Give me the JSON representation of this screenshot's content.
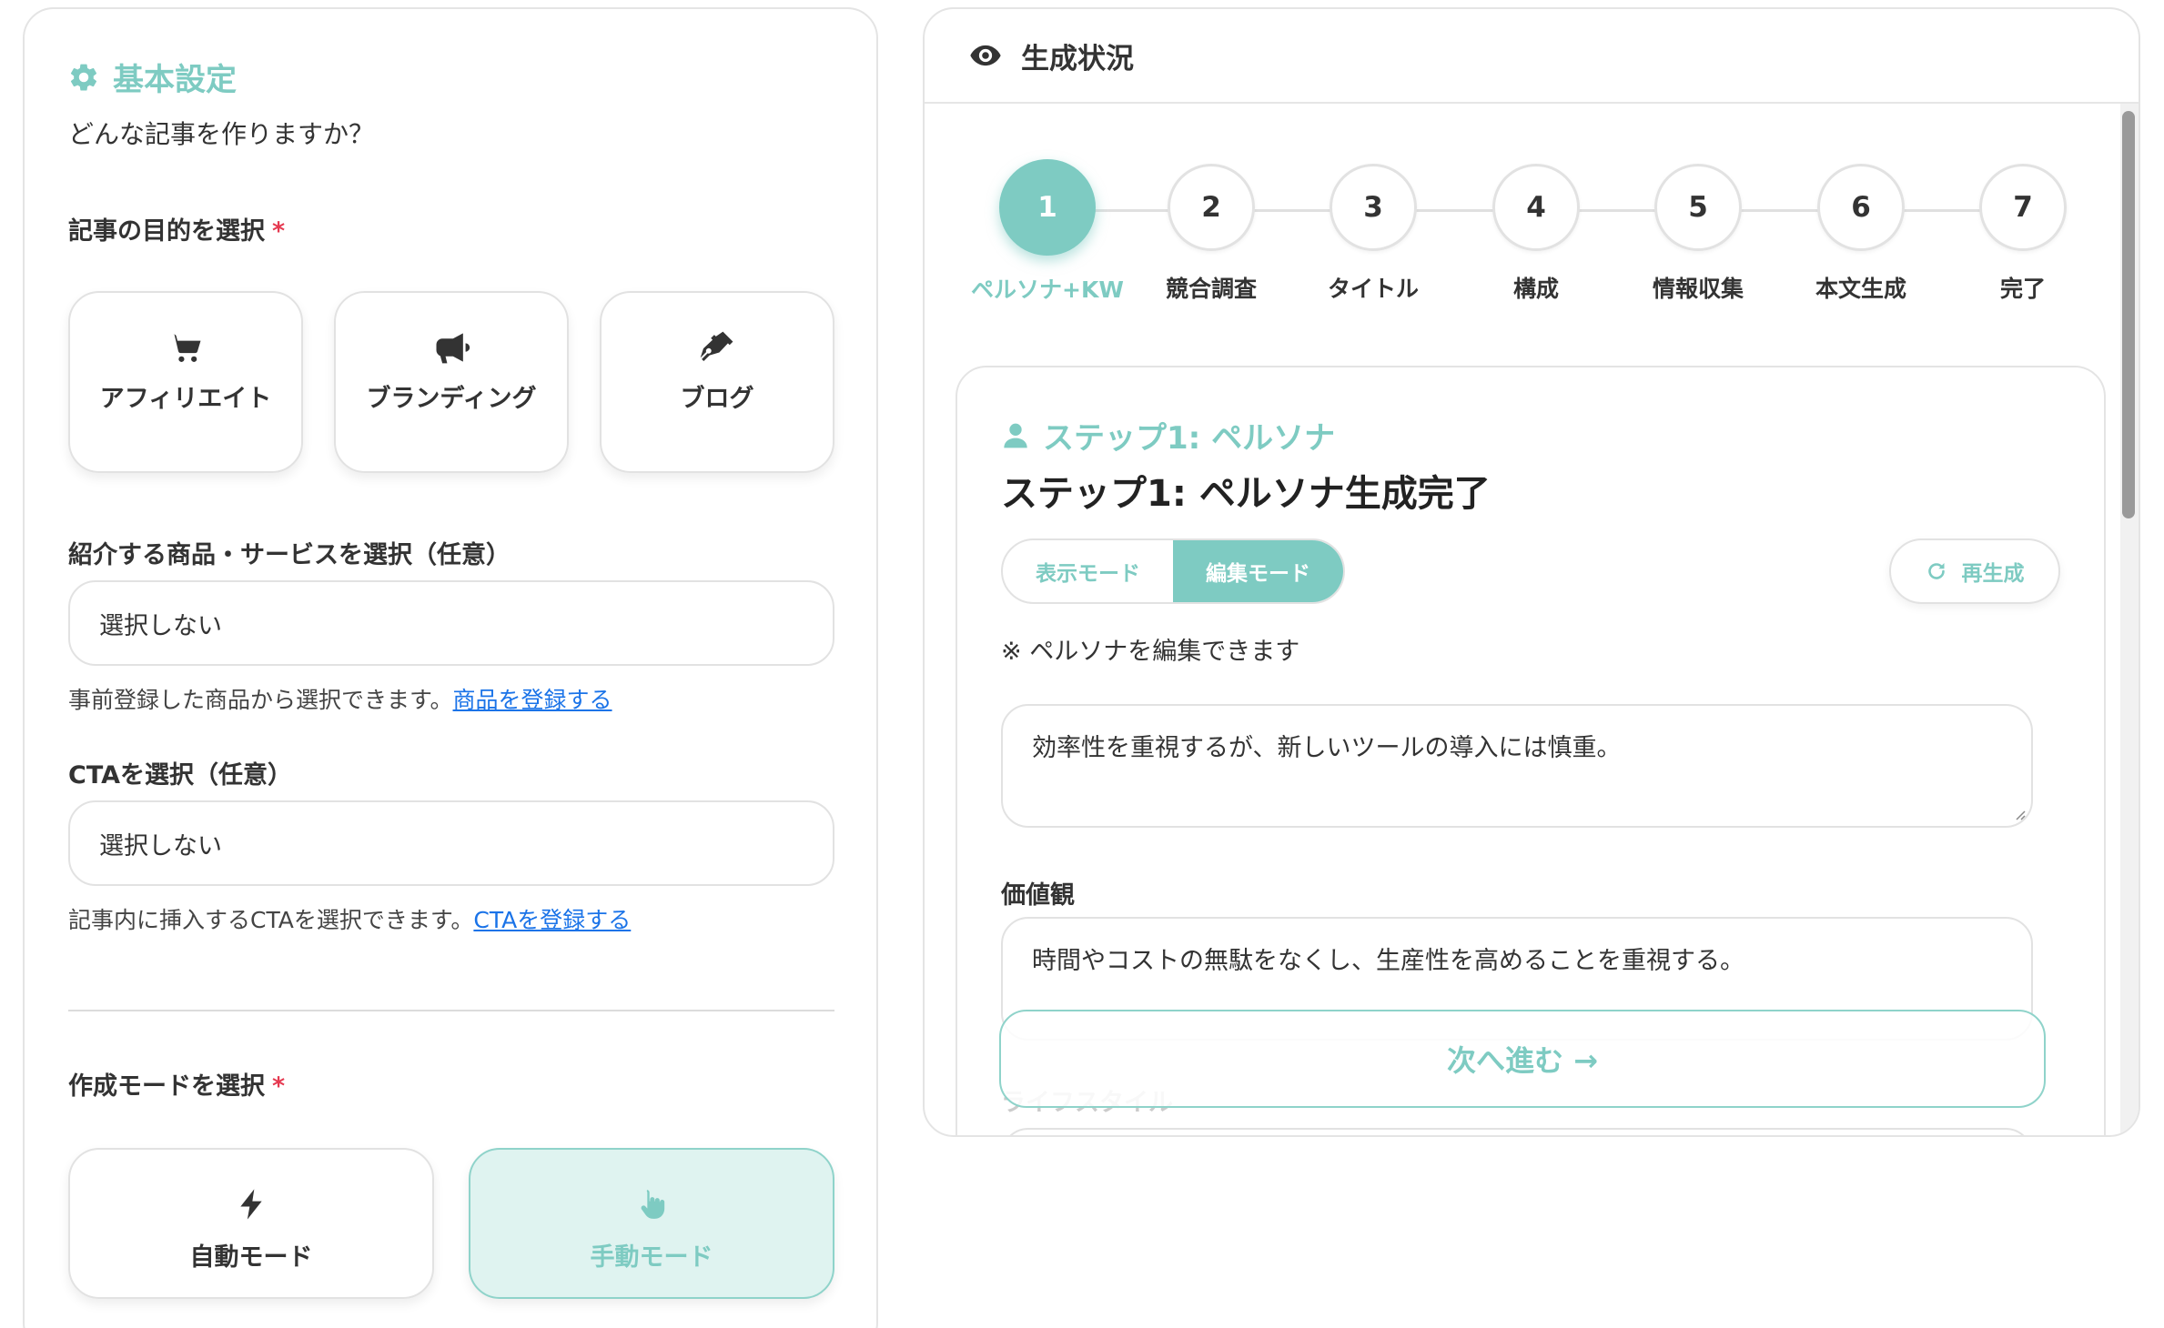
{
  "left": {
    "title": "基本設定",
    "subtitle": "どんな記事を作りますか？",
    "purpose_label": "記事の目的を選択",
    "required_mark": "*",
    "purposes": [
      {
        "label": "アフィリエイト",
        "icon": "cart-icon"
      },
      {
        "label": "ブランディング",
        "icon": "megaphone-icon"
      },
      {
        "label": "ブログ",
        "icon": "pen-icon"
      }
    ],
    "product_label": "紹介する商品・サービスを選択（任意）",
    "product_value": "選択しない",
    "product_help": "事前登録した商品から選択できます。",
    "product_link": "商品を登録する",
    "cta_label": "CTAを選択（任意）",
    "cta_value": "選択しない",
    "cta_help": "記事内に挿入するCTAを選択できます。",
    "cta_link": "CTAを登録する",
    "mode_label": "作成モードを選択",
    "modes": [
      {
        "label": "自動モード",
        "icon": "bolt-icon",
        "selected": false
      },
      {
        "label": "手動モード",
        "icon": "hand-pointer-icon",
        "selected": true
      }
    ]
  },
  "right": {
    "header_title": "生成状況",
    "steps": [
      {
        "num": "1",
        "label": "ペルソナ+KW",
        "active": true
      },
      {
        "num": "2",
        "label": "競合調査"
      },
      {
        "num": "3",
        "label": "タイトル"
      },
      {
        "num": "4",
        "label": "構成"
      },
      {
        "num": "5",
        "label": "情報収集"
      },
      {
        "num": "6",
        "label": "本文生成"
      },
      {
        "num": "7",
        "label": "完了"
      }
    ],
    "card_subtitle": "ステップ1: ペルソナ",
    "card_title": "ステップ1: ペルソナ生成完了",
    "toggle_view": "表示モード",
    "toggle_edit": "編集モード",
    "regen_label": "再生成",
    "note": "※ ペルソナを編集できます",
    "textarea1": "効率性を重視するが、新しいツールの導入には慎重。",
    "values_label": "価値観",
    "textarea2": "時間やコストの無駄をなくし、生産性を高めることを重視する。",
    "lifestyle_label": "ライフスタイル",
    "next_button": "次へ進む →"
  },
  "colors": {
    "accent": "#7ecbc2",
    "accent_light": "#dff3f0",
    "required": "#e53950",
    "link": "#1a73e8"
  }
}
